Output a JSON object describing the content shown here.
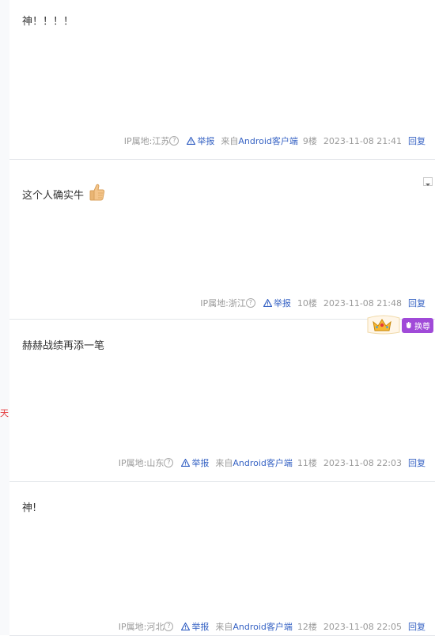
{
  "left_strip": {
    "mark": "天"
  },
  "posts": [
    {
      "content": "神！！！！",
      "ip_label": "IP属地:江苏",
      "report": "举报",
      "source_prefix": "来自",
      "source_app": "Android客户端",
      "floor": "9楼",
      "time": "2023-11-08 21:41",
      "reply": "回复"
    },
    {
      "content": "这个人确实牛",
      "emoji": "thumbs-up-icon",
      "ip_label": "IP属地:浙江",
      "report": "举报",
      "floor": "10楼",
      "time": "2023-11-08 21:48",
      "reply": "回复"
    },
    {
      "content": "赫赫战绩再添一笔",
      "badge_label": "换尊",
      "ip_label": "IP属地:山东",
      "report": "举报",
      "source_prefix": "来自",
      "source_app": "Android客户端",
      "floor": "11楼",
      "time": "2023-11-08 22:03",
      "reply": "回复"
    },
    {
      "content": "神!",
      "ip_label": "IP属地:河北",
      "report": "举报",
      "source_prefix": "来自",
      "source_app": "Android客户端",
      "floor": "12楼",
      "time": "2023-11-08 22:05",
      "reply": "回复"
    }
  ],
  "colors": {
    "link": "#3763c4",
    "meta": "#999999",
    "badge": "#a04ad8",
    "divider": "#e3e6ea"
  }
}
